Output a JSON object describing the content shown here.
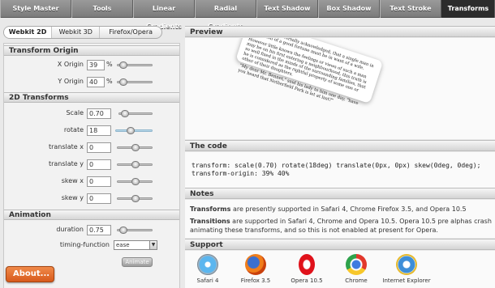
{
  "nav": {
    "tabs": [
      {
        "label": "Style Master",
        "active": false
      },
      {
        "label": "Tools",
        "active": false
      },
      {
        "label": "Linear Gradients",
        "active": false
      },
      {
        "label": "Radial Gradients",
        "active": false
      },
      {
        "label": "Text Shadow",
        "active": false
      },
      {
        "label": "Box Shadow",
        "active": false
      },
      {
        "label": "Text Stroke",
        "active": false
      },
      {
        "label": "Transforms",
        "active": true
      }
    ]
  },
  "subtabs": [
    {
      "label": "Webkit 2D",
      "active": true
    },
    {
      "label": "Webkit 3D",
      "active": false
    },
    {
      "label": "Firefox/Opera",
      "active": false
    }
  ],
  "transform_origin": {
    "title": "Transform Origin",
    "x": {
      "label": "X Origin",
      "value": "39",
      "unit": "%"
    },
    "y": {
      "label": "Y Origin",
      "value": "40",
      "unit": "%"
    }
  },
  "transforms_2d": {
    "title": "2D Transforms",
    "scale": {
      "label": "Scale",
      "value": "0.70"
    },
    "rotate": {
      "label": "rotate",
      "value": "18"
    },
    "translate_x": {
      "label": "translate x",
      "value": "0"
    },
    "translate_y": {
      "label": "translate y",
      "value": "0"
    },
    "skew_x": {
      "label": "skew x",
      "value": "0"
    },
    "skew_y": {
      "label": "skew y",
      "value": "0"
    }
  },
  "animation": {
    "title": "Animation",
    "duration": {
      "label": "duration",
      "value": "0.75"
    },
    "timing": {
      "label": "timing-function",
      "value": "ease"
    },
    "animate_label": "Animate"
  },
  "about_label": "About...",
  "preview": {
    "title": "Preview",
    "p1": "It is a truth universally acknowledged, that a single man in possession of a good fortune must be in want of a wife.",
    "p2": "However little known the feelings or views of such a man may be on his first entering a neighbourhood, this truth is so well fixed in the minds of the surrounding families, that he is considered as the rightful property of some one or other of their daughters.",
    "p3": "\"My dear Mr. Bennet,\" said his lady to him one day, \"have you heard that Netherfield Park is let at last?\""
  },
  "code": {
    "title": "The code",
    "text": "transform: scale(0.70) rotate(18deg) translate(0px, 0px) skew(0deg, 0deg); transform-origin: 39% 40%"
  },
  "notes": {
    "title": "Notes",
    "n1_bold": "Transforms",
    "n1_text": " are presently supported in Safari 4, Chrome Firefox 3.5, and Opera 10.5",
    "n2_bold": "Transitions",
    "n2_text": " are supported in Safari 4, Chrome and Opera 10.5. Opera 10.5 pre alphas crash animating these transforms, and so this is not enabled at present for Opera."
  },
  "support": {
    "title": "Support",
    "browsers": [
      {
        "label": "Safari 4",
        "icon": "safari-icon"
      },
      {
        "label": "Firefox 3.5",
        "icon": "firefox-icon"
      },
      {
        "label": "Opera 10.5",
        "icon": "opera-icon"
      },
      {
        "label": "Chrome",
        "icon": "chrome-icon"
      },
      {
        "label": "Internet Explorer",
        "icon": "ie-icon"
      }
    ]
  }
}
